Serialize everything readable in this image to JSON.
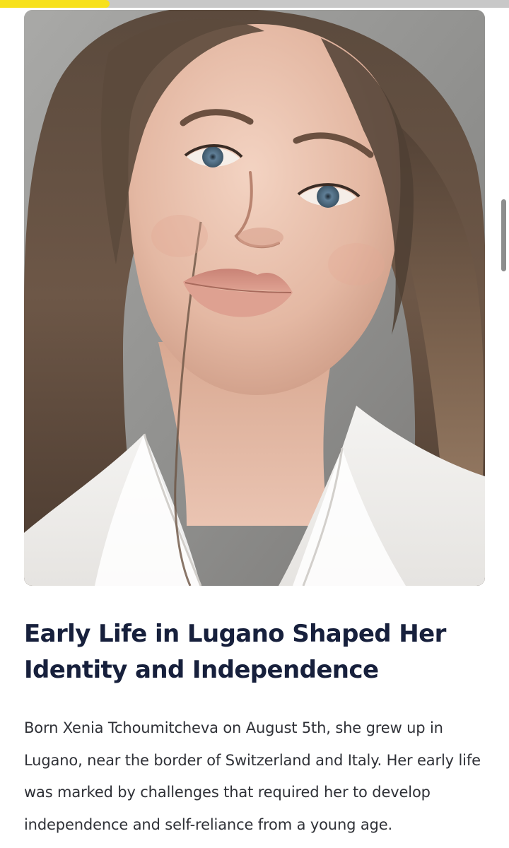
{
  "reading_progress": {
    "fraction": 0.215,
    "color": "#f7e11b"
  },
  "scrollbar": {
    "position_fraction": 0.249
  },
  "image": {
    "icon_name": "portrait-photo-icon"
  },
  "article": {
    "heading": "Early Life in Lugano Shaped Her Identity and Independence",
    "paragraph": "Born Xenia Tchoumitcheva on August 5th, she grew up in Lugano, near the border of Switzerland and Italy. Her early life was marked by challenges that required her to develop independence and self-reliance from a young age."
  },
  "colors": {
    "heading": "#17203c",
    "body": "#2f3137",
    "progress_track": "#c8c8c8"
  }
}
